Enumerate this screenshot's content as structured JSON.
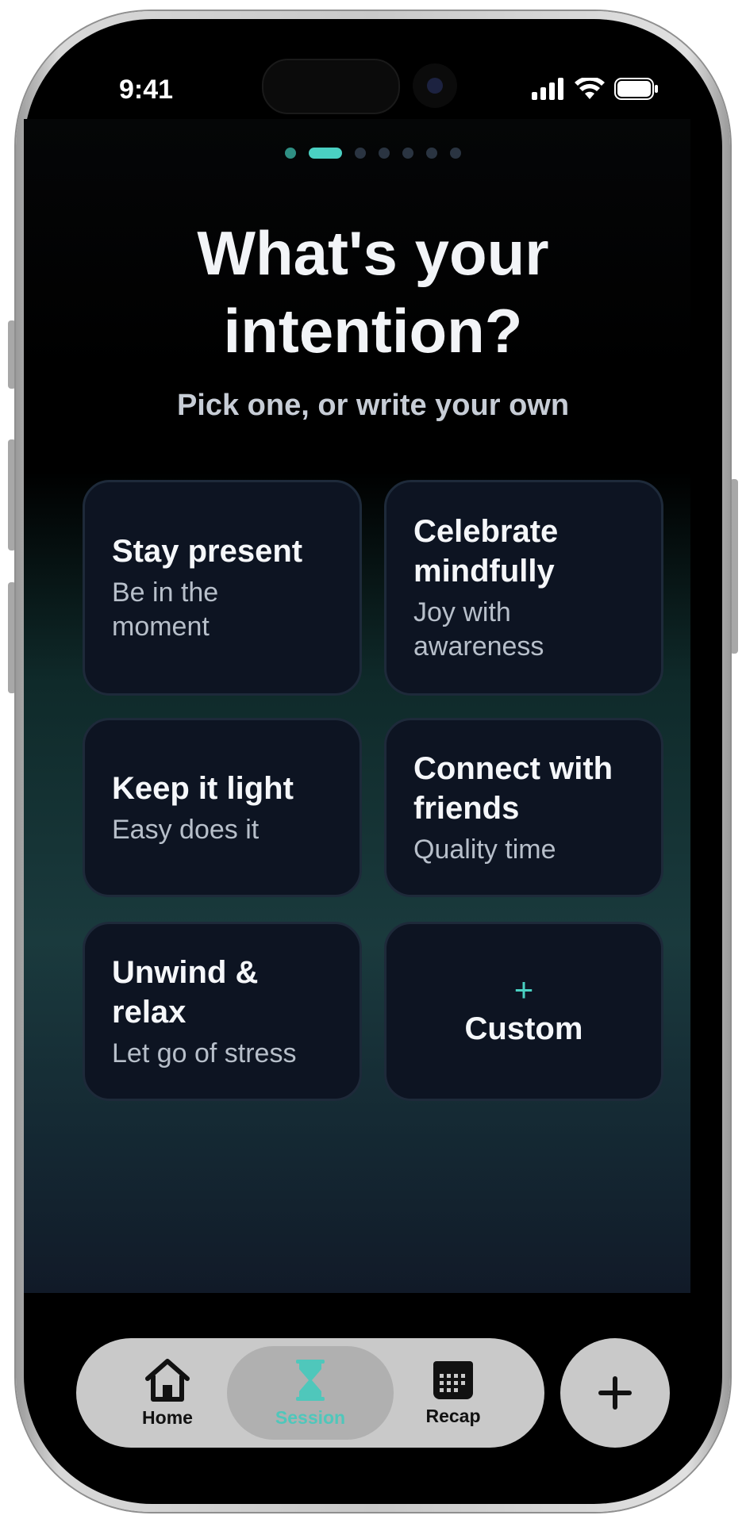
{
  "status_bar": {
    "time": "9:41"
  },
  "onboarding": {
    "step_count": 7,
    "current_step": 2,
    "title_line1": "What's your",
    "title_line2": "intention?",
    "subtitle": "Pick one, or write your own"
  },
  "intentions": [
    {
      "title": "Stay present",
      "description": "Be in the moment"
    },
    {
      "title": "Celebrate mindfully",
      "description": "Joy with awareness"
    },
    {
      "title": "Keep it light",
      "description": "Easy does it"
    },
    {
      "title": "Connect with friends",
      "description": "Quality time"
    },
    {
      "title": "Unwind & relax",
      "description": "Let go of stress"
    }
  ],
  "custom_option": {
    "label": "Custom",
    "icon": "plus-icon"
  },
  "tab_bar": {
    "tabs": [
      {
        "label": "Home",
        "icon": "home-icon"
      },
      {
        "label": "Session",
        "icon": "hourglass-icon",
        "active": true
      },
      {
        "label": "Recap",
        "icon": "calendar-icon"
      }
    ],
    "fab_icon": "plus-icon"
  },
  "colors": {
    "accent": "#4ad0c2",
    "card_bg": "#0d1422",
    "tabbar_bg": "#c9c9c9"
  }
}
